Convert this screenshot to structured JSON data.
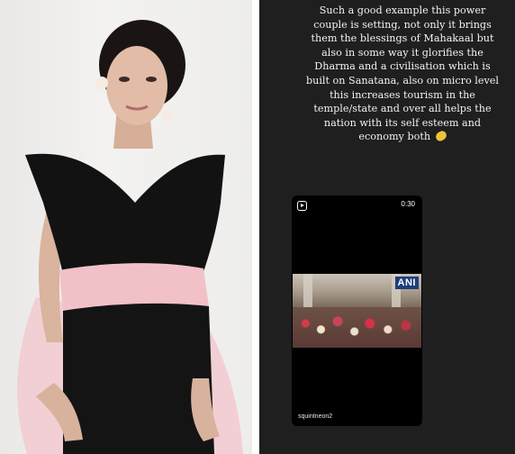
{
  "story": {
    "caption": "Such a good example this power couple is setting, not only it brings them the blessings of Mahakaal  but also in some way it glorifies the Dharma and a civilisation which is built on Sanatana, also on micro level this increases tourism in the temple/state and over all helps the nation with its self esteem and economy both",
    "caption_emoji": "folded-hands-emoji",
    "reel": {
      "duration": "0:30",
      "watermark": "ANI",
      "username": "squintneon2",
      "icon": "reel-icon"
    }
  },
  "colors": {
    "story_bg": "#1f1f1f",
    "ani_badge": "#1d3f7a"
  }
}
